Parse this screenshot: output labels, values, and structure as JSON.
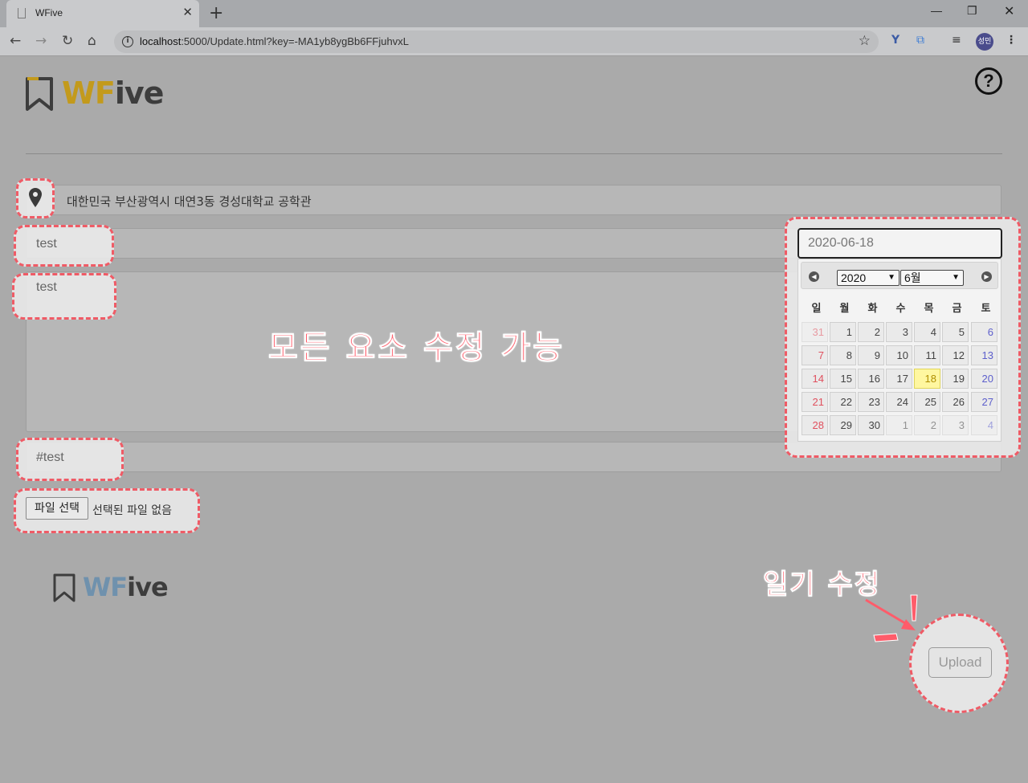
{
  "browser": {
    "tab_title": "WFive",
    "url_host": "localhost",
    "url_rest": ":5000/Update.html?key=-MA1yb8ygBb6FFjuhvxL",
    "avatar": "성민",
    "icons": [
      "back-icon",
      "forward-icon",
      "reload-icon",
      "home-icon",
      "info-icon",
      "star-icon",
      "extension-icon",
      "translate-icon",
      "media-icon",
      "menu-icon"
    ]
  },
  "brand": {
    "logo_main": "WF",
    "logo_rest": "ive",
    "brand_color": "#c39a1c"
  },
  "help_symbol": "?",
  "form": {
    "location": "대한민국 부산광역시 대연3동 경성대학교 공학관",
    "title": "test",
    "content": "test",
    "tags": "#test",
    "file_button": "파일 선택",
    "file_status": "선택된 파일 없음"
  },
  "annotations": {
    "main": "모든 요소 수정 가능",
    "diary": "일기 수정",
    "color": "#ff5c6a"
  },
  "datepicker": {
    "value": "2020-06-18",
    "year": "2020",
    "month": "6월",
    "weekdays": [
      "일",
      "월",
      "화",
      "수",
      "목",
      "금",
      "토"
    ],
    "weeks": [
      [
        "31",
        "1",
        "2",
        "3",
        "4",
        "5",
        "6"
      ],
      [
        "7",
        "8",
        "9",
        "10",
        "11",
        "12",
        "13"
      ],
      [
        "14",
        "15",
        "16",
        "17",
        "18",
        "19",
        "20"
      ],
      [
        "21",
        "22",
        "23",
        "24",
        "25",
        "26",
        "27"
      ],
      [
        "28",
        "29",
        "30",
        "1",
        "2",
        "3",
        "4"
      ]
    ],
    "today": "18"
  },
  "footer": {
    "logo_main": "WF",
    "logo_rest": "ive"
  },
  "upload_label": "Upload"
}
